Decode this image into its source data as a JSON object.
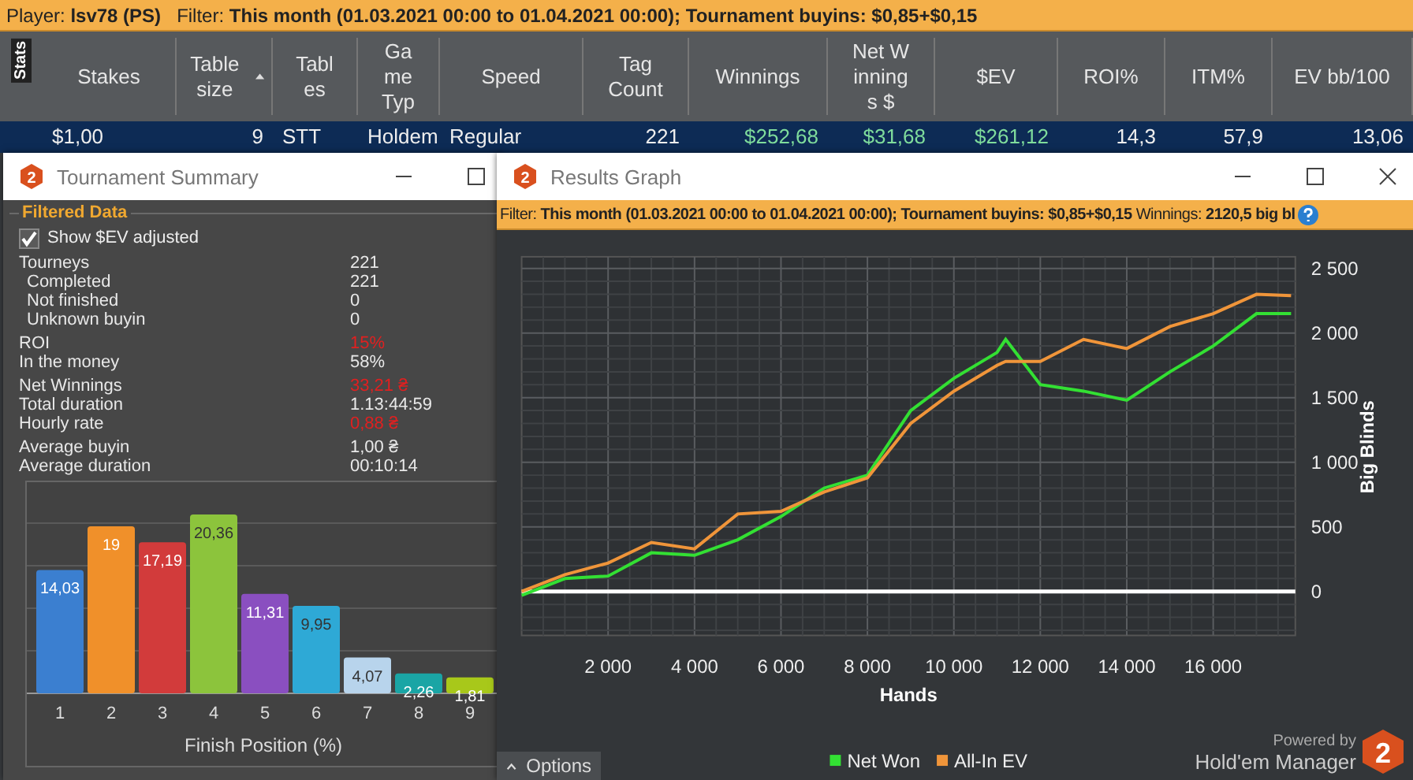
{
  "top_filter": "Player: **lsv78 (PS)**   Filter: **This month (01.03.2021 00:00 to 01.04.2021 00:00); Tournament buyins: $0,85+$0,15**",
  "stats_tab": "Stats",
  "table": {
    "columns": [
      {
        "label": "Stakes",
        "kind": "text",
        "sorted": false
      },
      {
        "label": "Table size",
        "kind": "number",
        "sorted": true
      },
      {
        "label": "Tables",
        "kind": "text",
        "sorted": false
      },
      {
        "label": "Game Typ",
        "kind": "text",
        "sorted": false
      },
      {
        "label": "Speed",
        "kind": "text",
        "sorted": false
      },
      {
        "label": "Tag Count",
        "kind": "number",
        "sorted": false
      },
      {
        "label": "Winnings",
        "kind": "money",
        "sorted": false
      },
      {
        "label": "Net Winnings $",
        "kind": "money",
        "sorted": false
      },
      {
        "label": "$EV",
        "kind": "money",
        "sorted": false
      },
      {
        "label": "ROI%",
        "kind": "number",
        "sorted": false
      },
      {
        "label": "ITM%",
        "kind": "number",
        "sorted": false
      },
      {
        "label": "EV bb/100",
        "kind": "number",
        "sorted": false
      }
    ],
    "rows": [
      {
        "selected": true,
        "cells": [
          "$1,00",
          "9",
          "STT",
          "Holdem",
          "Regular",
          "221",
          "$252,68",
          "$31,68",
          "$261,12",
          "14,3",
          "57,9",
          "13,06"
        ]
      }
    ]
  },
  "summary_window": {
    "icon_text": "2",
    "title": "Tournament Summary",
    "section": "Filtered Data",
    "show_ev": {
      "label": "Show $EV adjusted",
      "checked": true
    },
    "groups": [
      [
        {
          "label": "Tourneys",
          "value": "221",
          "indented": false,
          "highlight": false
        },
        {
          "label": "Completed",
          "value": "221",
          "indented": true,
          "highlight": false
        },
        {
          "label": "Not finished",
          "value": "0",
          "indented": true,
          "highlight": false
        },
        {
          "label": "Unknown buyin",
          "value": "0",
          "indented": true,
          "highlight": false
        }
      ],
      [
        {
          "label": "ROI",
          "value": "15%",
          "indented": false,
          "highlight": true
        },
        {
          "label": "In the money",
          "value": "58%",
          "indented": false,
          "highlight": false
        }
      ],
      [
        {
          "label": "Net Winnings",
          "value": "33,21 ₴",
          "indented": false,
          "highlight": true
        },
        {
          "label": "Total duration",
          "value": "1.13:44:59",
          "indented": false,
          "highlight": false
        },
        {
          "label": "Hourly rate",
          "value": "0,88 ₴",
          "indented": false,
          "highlight": true
        }
      ],
      [
        {
          "label": "Average buyin",
          "value": "1,00 ₴",
          "indented": false,
          "highlight": false
        },
        {
          "label": "Average duration",
          "value": "00:10:14",
          "indented": false,
          "highlight": false
        }
      ]
    ],
    "chart_data": {
      "type": "bar",
      "xlabel": "Finish Position (%)",
      "categories": [
        "1",
        "2",
        "3",
        "4",
        "5",
        "6",
        "7",
        "8",
        "9"
      ],
      "values": [
        14.03,
        19,
        17.19,
        20.36,
        11.31,
        9.95,
        4.07,
        2.26,
        1.81
      ],
      "value_labels": [
        "14,03",
        "19",
        "17,19",
        "20,36",
        "11,31",
        "9,95",
        "4,07",
        "2,26",
        "1,81"
      ]
    }
  },
  "graph_window": {
    "icon_text": "2",
    "title": "Results Graph",
    "filter": "Filter: **This month (01.03.2021 00:00 to 01.04.2021 00:00); Tournament buyins: $0,85+$0,15** Winnings: **2120,5 big bl**",
    "chart_data": {
      "type": "line",
      "xlabel": "Hands",
      "ylabel": "Big Blinds",
      "x": [
        0,
        1000,
        2000,
        3000,
        4000,
        5000,
        6000,
        7000,
        8000,
        9000,
        10000,
        11000,
        11200,
        12000,
        13000,
        14000,
        15000,
        16000,
        17000,
        17800
      ],
      "series": [
        {
          "name": "Net Won",
          "color": "#33e033",
          "values": [
            -30,
            100,
            120,
            300,
            280,
            400,
            580,
            800,
            900,
            1400,
            1650,
            1850,
            1950,
            1600,
            1550,
            1480,
            1700,
            1900,
            2150,
            2150
          ]
        },
        {
          "name": "All-In EV",
          "color": "#f0953a",
          "values": [
            0,
            130,
            220,
            380,
            330,
            600,
            620,
            770,
            880,
            1300,
            1550,
            1750,
            1780,
            1780,
            1950,
            1880,
            2050,
            2150,
            2300,
            2290
          ]
        }
      ],
      "xlim": [
        0,
        17900
      ],
      "ylim": [
        -340,
        2590
      ],
      "grid": true,
      "legend": "bottom",
      "xticks": [
        {
          "value": 2000,
          "label": "2 000"
        },
        {
          "value": 4000,
          "label": "4 000"
        },
        {
          "value": 6000,
          "label": "6 000"
        },
        {
          "value": 8000,
          "label": "8 000"
        },
        {
          "value": 10000,
          "label": "10 000"
        },
        {
          "value": 12000,
          "label": "12 000"
        },
        {
          "value": 14000,
          "label": "14 000"
        },
        {
          "value": 16000,
          "label": "16 000"
        }
      ],
      "yticks": [
        {
          "value": 0,
          "label": "0"
        },
        {
          "value": 500,
          "label": "500"
        },
        {
          "value": 1000,
          "label": "1 000"
        },
        {
          "value": 1500,
          "label": "1 500"
        },
        {
          "value": 2000,
          "label": "2 000"
        },
        {
          "value": 2500,
          "label": "2 500"
        }
      ]
    },
    "options_label": "Options",
    "powered_by": "Powered by",
    "brand": "Hold'em Manager",
    "logo_text": "2"
  }
}
